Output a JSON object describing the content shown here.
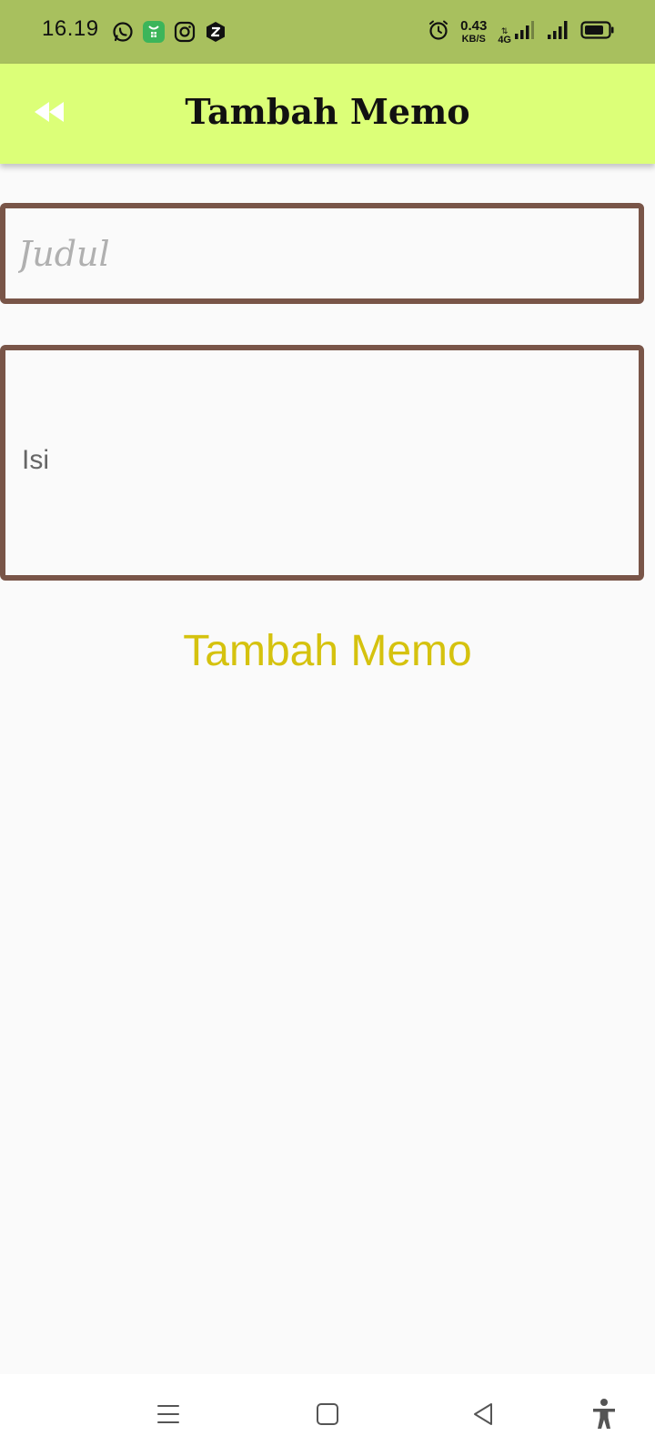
{
  "status_bar": {
    "time": "16.19",
    "net_speed_value": "0.43",
    "net_speed_unit": "KB/S",
    "net_type": "4G",
    "icons": [
      "whatsapp-icon",
      "store-icon",
      "instagram-icon",
      "z-app-icon",
      "alarm-icon",
      "signal-icon",
      "signal-icon",
      "battery-icon"
    ]
  },
  "app_bar": {
    "title": "Tambah Memo",
    "back_icon": "rewind-back-icon",
    "background": "#dcff78"
  },
  "form": {
    "title_placeholder": "Judul",
    "title_value": "",
    "body_placeholder": "Isi",
    "body_value": "",
    "border_color": "#795548"
  },
  "actions": {
    "add_label": "Tambah Memo",
    "add_color": "#d5c20e"
  },
  "nav_bar": {
    "items": [
      "menu-icon",
      "home-icon",
      "back-icon",
      "accessibility-icon"
    ]
  }
}
